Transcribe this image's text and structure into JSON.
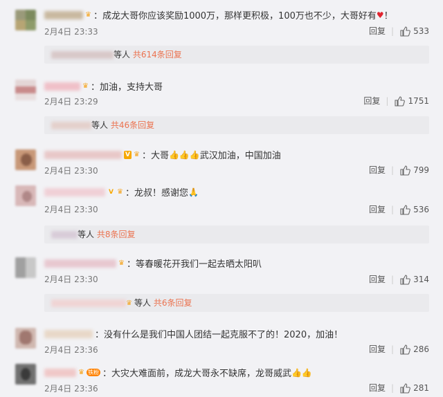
{
  "colors": {
    "accent": "#eb7350",
    "background": "#f2f2f5",
    "subbox": "#eaeaed"
  },
  "comments": [
    {
      "text": "：成龙大哥你应该奖励1000万，那样更积极，100万也不少，大哥好有",
      "emoji_after": "heart-emoji",
      "trail": "！",
      "time": "2月4日 23:33",
      "reply": "回复",
      "likes": "533",
      "sub": {
        "others": "等人",
        "count": "共614条回复"
      }
    },
    {
      "text": "：加油，支持大哥",
      "time": "2月4日 23:29",
      "reply": "回复",
      "likes": "1751",
      "sub": {
        "others": "等人",
        "count": "共46条回复"
      }
    },
    {
      "text_a": "：大哥",
      "text_b": "武汉加油，中国加油",
      "time": "2月4日 23:30",
      "reply": "回复",
      "likes": "799"
    },
    {
      "text": "：龙叔！感谢您",
      "time": "2月4日 23:30",
      "reply": "回复",
      "likes": "536",
      "sub": {
        "others": "等人",
        "count": "共8条回复"
      }
    },
    {
      "text": "：等春暖花开我们一起去晒太阳叭",
      "time": "2月4日 23:30",
      "reply": "回复",
      "likes": "314",
      "sub": {
        "others": "等人",
        "count": "共6条回复"
      }
    },
    {
      "text": "：没有什么是我们中国人团结一起克服不了的！2020，加油！",
      "time": "2月4日 23:36",
      "reply": "回复",
      "likes": "286"
    },
    {
      "badge": "铁粉",
      "text": "：大灾大难面前，成龙大哥永不缺席，龙哥威武",
      "time": "2月4日 23:36",
      "reply": "回复",
      "likes": "281"
    }
  ]
}
